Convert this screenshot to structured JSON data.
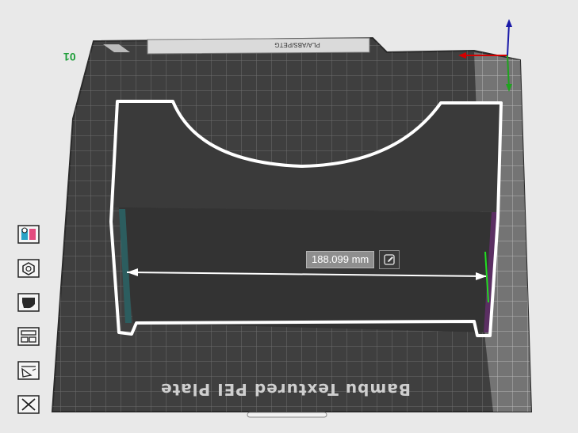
{
  "plate": {
    "id_label": "01",
    "name": "Bambu Textured PEI Plate",
    "filament_text": "PLA/ABS/PETG"
  },
  "measurement": {
    "value": "188.099 mm"
  },
  "toolbar": {
    "buttons": [
      {
        "icon": "color-paint-icon"
      },
      {
        "icon": "hexagon-icon"
      },
      {
        "icon": "support-paint-icon"
      },
      {
        "icon": "layout-icon"
      },
      {
        "icon": "cut-icon"
      },
      {
        "icon": "close-icon"
      }
    ]
  },
  "colors": {
    "plate": "#3d3d3d",
    "grid": "#6b6b6b",
    "object_outline": "#ffffff",
    "axis_x": "#d40000",
    "axis_y": "#1ea31e",
    "axis_z": "#1a1aa8"
  }
}
